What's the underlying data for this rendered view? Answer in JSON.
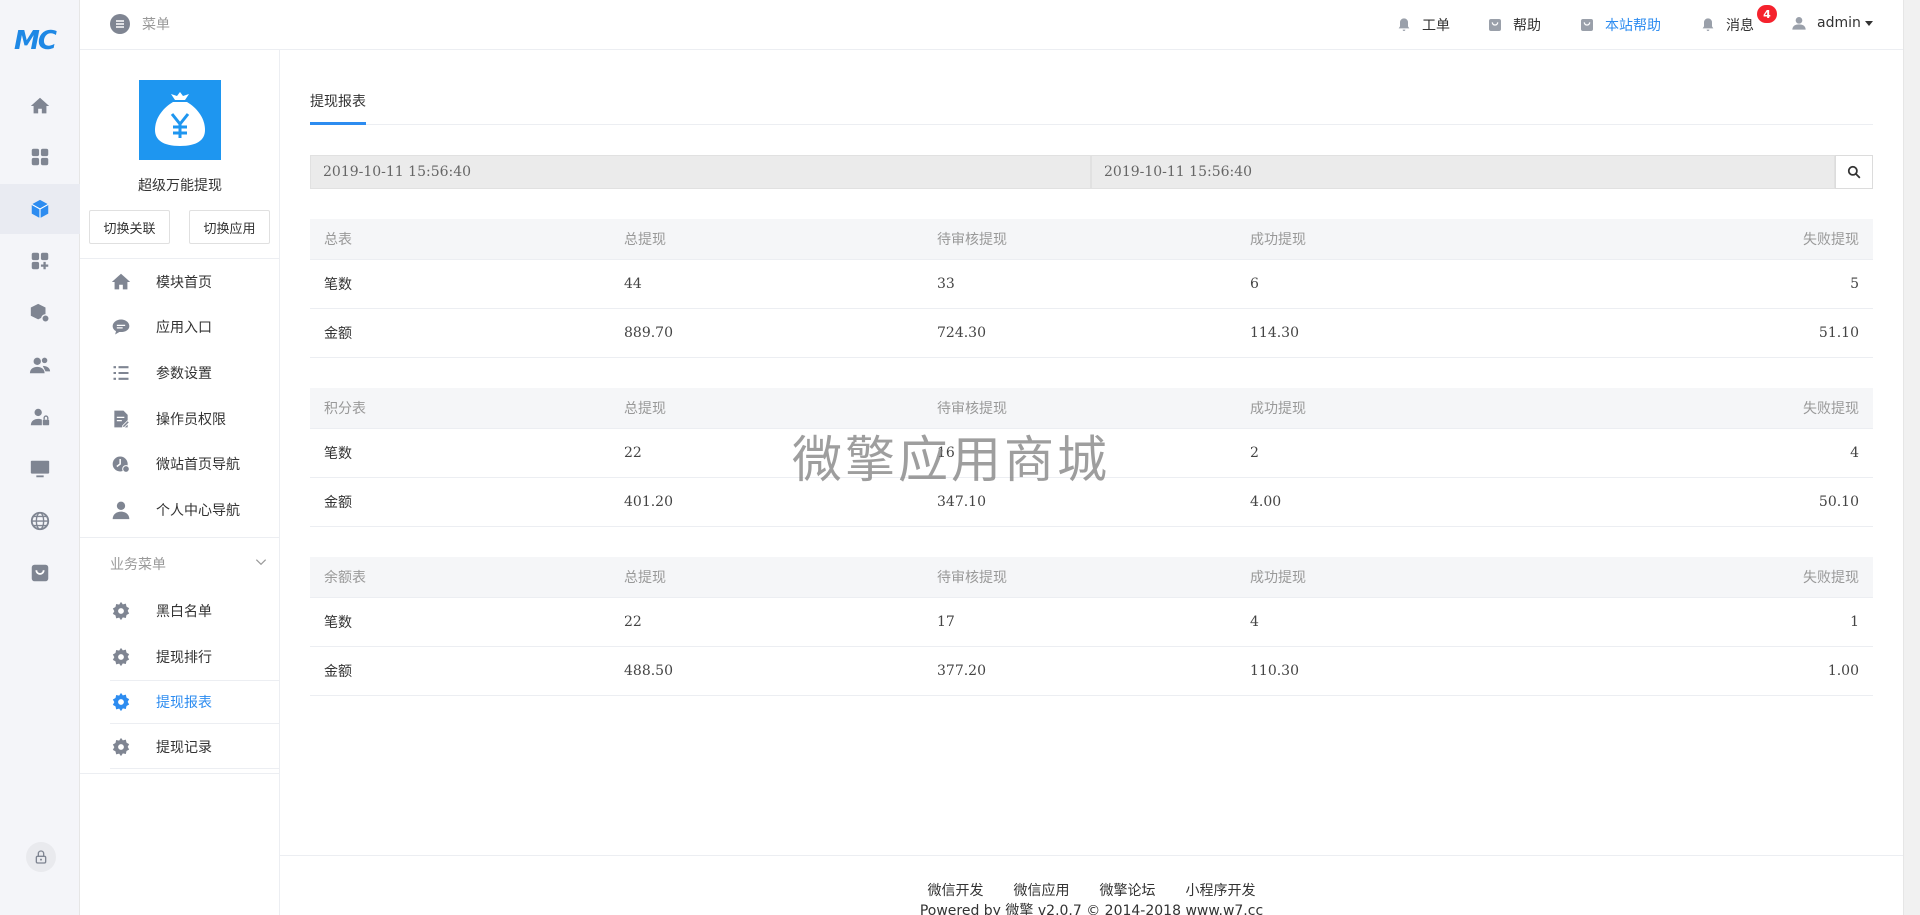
{
  "header": {
    "menu_label": "菜单",
    "items": [
      {
        "label": "工单",
        "icon": "bell-icon"
      },
      {
        "label": "帮助",
        "icon": "shopping-bag-icon"
      },
      {
        "label": "本站帮助",
        "icon": "shopping-bag-icon"
      },
      {
        "label": "消息",
        "icon": "bell-icon",
        "badge": "4"
      },
      {
        "label": "admin",
        "icon": "user-icon"
      }
    ]
  },
  "rail": {
    "logo": "MC",
    "items": [
      "home-icon",
      "apps-grid-icon",
      "cube-icon",
      "apps-add-icon",
      "module-settings-icon",
      "users-icon",
      "user-lock-icon",
      "monitor-icon",
      "globe-icon",
      "store-icon"
    ],
    "active_index": 2,
    "bottom_icon": "lock-icon"
  },
  "module": {
    "name": "超级万能提现",
    "icon": "money-bag-yen-icon",
    "switch_link": "切换关联",
    "switch_app": "切换应用",
    "nav": [
      {
        "label": "模块首页",
        "icon": "home-icon"
      },
      {
        "label": "应用入口",
        "icon": "chat-icon"
      },
      {
        "label": "参数设置",
        "icon": "list-icon"
      },
      {
        "label": "操作员权限",
        "icon": "document-edit-icon"
      },
      {
        "label": "微站首页导航",
        "icon": "clock-nav-icon"
      },
      {
        "label": "个人中心导航",
        "icon": "user-icon"
      }
    ],
    "section_title": "业务菜单",
    "business_nav": [
      {
        "label": "黑白名单",
        "icon": "gear-icon"
      },
      {
        "label": "提现排行",
        "icon": "gear-icon"
      },
      {
        "label": "提现报表",
        "icon": "gear-icon",
        "active": true
      },
      {
        "label": "提现记录",
        "icon": "gear-icon"
      }
    ]
  },
  "main": {
    "tab": "提现报表",
    "filter": {
      "start_date": "2019-10-11 15:56:40",
      "end_date": "2019-10-11 15:56:40"
    },
    "tables": [
      {
        "headers": [
          "总表",
          "总提现",
          "待审核提现",
          "成功提现",
          "失败提现"
        ],
        "rows": [
          [
            "笔数",
            "44",
            "33",
            "6",
            "5"
          ],
          [
            "金额",
            "889.70",
            "724.30",
            "114.30",
            "51.10"
          ]
        ]
      },
      {
        "headers": [
          "积分表",
          "总提现",
          "待审核提现",
          "成功提现",
          "失败提现"
        ],
        "rows": [
          [
            "笔数",
            "22",
            "16",
            "2",
            "4"
          ],
          [
            "金额",
            "401.20",
            "347.10",
            "4.00",
            "50.10"
          ]
        ]
      },
      {
        "headers": [
          "余额表",
          "总提现",
          "待审核提现",
          "成功提现",
          "失败提现"
        ],
        "rows": [
          [
            "笔数",
            "22",
            "17",
            "4",
            "1"
          ],
          [
            "金额",
            "488.50",
            "377.20",
            "110.30",
            "1.00"
          ]
        ]
      }
    ]
  },
  "watermark": "微擎应用商城",
  "footer": {
    "links": [
      "微信开发",
      "微信应用",
      "微擎论坛",
      "小程序开发"
    ],
    "copyright": "Powered by 微擎 v2.0.7 © 2014-2018 www.w7.cc"
  },
  "colors": {
    "accent": "#2d8cf0",
    "module_icon_bg": "#1e96f0",
    "badge": "#f5222d"
  }
}
